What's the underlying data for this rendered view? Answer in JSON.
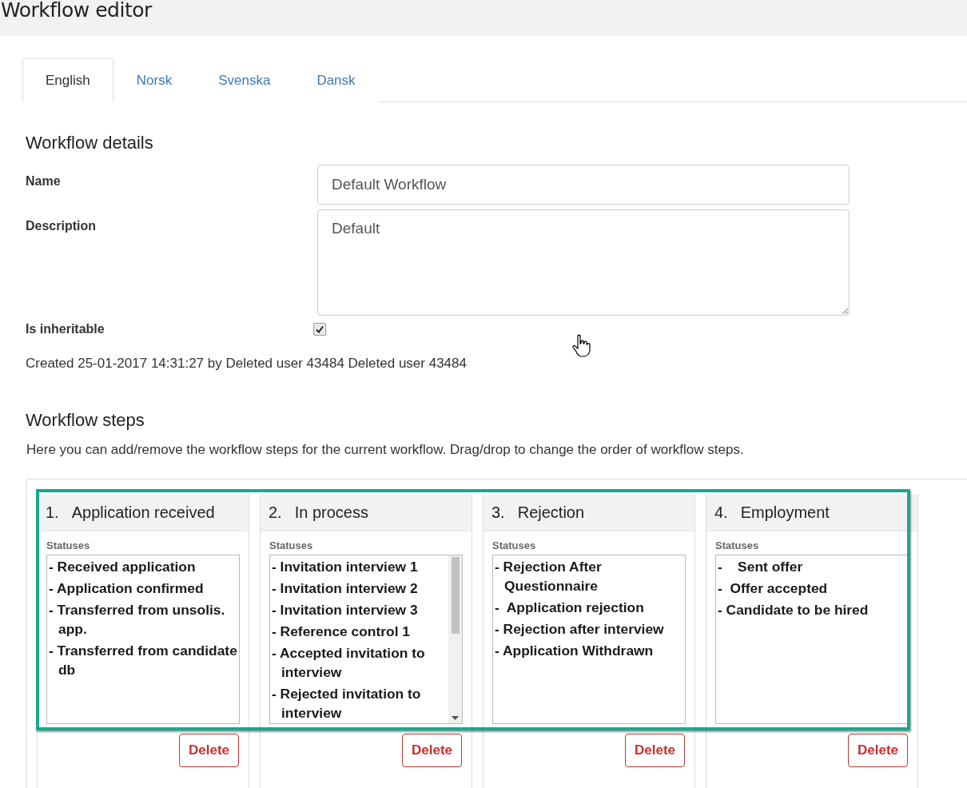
{
  "page_title": "Workflow editor",
  "tabs": [
    {
      "label": "English",
      "selected": true
    },
    {
      "label": "Norsk",
      "selected": false
    },
    {
      "label": "Svenska",
      "selected": false
    },
    {
      "label": "Dansk",
      "selected": false
    }
  ],
  "details": {
    "heading": "Workflow details",
    "name_label": "Name",
    "name_value": "Default Workflow",
    "description_label": "Description",
    "description_value": "Default",
    "inheritable_label": "Is inheritable",
    "inheritable_checked": true,
    "created": "Created 25-01-2017 14:31:27 by Deleted user 43484 Deleted user 43484"
  },
  "steps": {
    "heading": "Workflow steps",
    "intro": "Here you can add/remove the workflow steps for the current workflow. Drag/drop to change the order of workflow steps.",
    "highlighted": true,
    "columns": [
      {
        "number": "1.",
        "title": "Application received",
        "statuses_label": "Statuses",
        "scrollable": false,
        "statuses": [
          "- Received application",
          "- Application confirmed",
          "- Transferred from unsolis. app.",
          "- Transferred from candidate db"
        ],
        "delete": "Delete"
      },
      {
        "number": "2.",
        "title": "In process",
        "statuses_label": "Statuses",
        "scrollable": true,
        "statuses": [
          "- Invitation interview 1",
          "- Invitation interview 2",
          "- Invitation interview 3",
          "- Reference control 1",
          "- Accepted invitation to interview",
          "- Rejected invitation to interview"
        ],
        "delete": "Delete"
      },
      {
        "number": "3.",
        "title": "Rejection",
        "statuses_label": "Statuses",
        "scrollable": false,
        "statuses": [
          "- Rejection After Questionnaire",
          "-  Application rejection",
          "- Rejection after interview",
          "- Application Withdrawn"
        ],
        "delete": "Delete"
      },
      {
        "number": "4.",
        "title": "Employment",
        "statuses_label": "Statuses",
        "scrollable": false,
        "statuses": [
          "-    Sent offer",
          "-  Offer accepted",
          "- Candidate to be hired"
        ],
        "delete": "Delete"
      }
    ]
  }
}
